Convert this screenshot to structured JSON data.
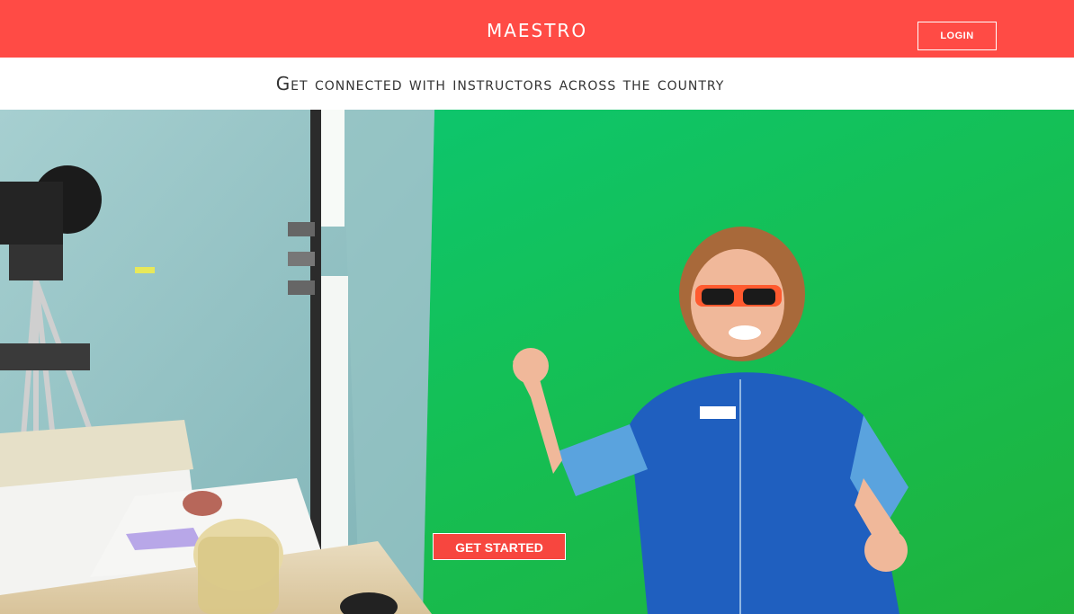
{
  "header": {
    "brand": "maestro",
    "login_label": "LOGIN"
  },
  "tagline": "Get connected with instructors across the country",
  "hero": {
    "image_icon": "hero-photo-instructor-green-screen",
    "cta_label": "GET STARTED"
  },
  "colors": {
    "brand": "#ff4b45",
    "cta": "#f7463f",
    "green_screen": "#18c26a"
  }
}
